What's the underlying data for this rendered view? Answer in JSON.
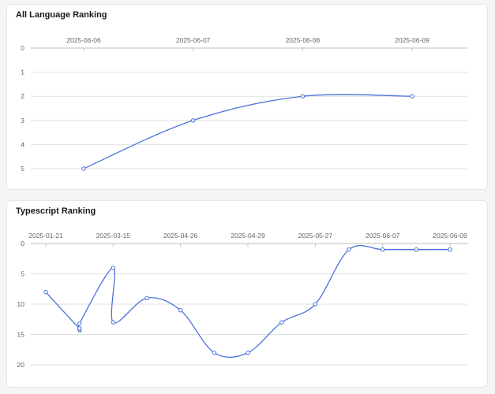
{
  "colors": {
    "line": "#4a72d8",
    "grid": "#e0e0e0",
    "axis": "#bfbfbf",
    "text": "#666666"
  },
  "charts": [
    {
      "title": "All Language Ranking",
      "chart_data": {
        "type": "line",
        "x_axis_position": "top",
        "y_inverted": true,
        "ylim": [
          0,
          5
        ],
        "y_ticks": [
          0,
          1,
          2,
          3,
          4,
          5
        ],
        "x_labels": [
          "2025-06-06",
          "2025-06-07",
          "2025-06-08",
          "2025-06-09"
        ],
        "x": [
          0,
          1,
          2,
          3
        ],
        "values": [
          5,
          3,
          2,
          2
        ],
        "smooth": true,
        "xlabel": "",
        "ylabel": "",
        "grid": true,
        "legend": "none"
      }
    },
    {
      "title": "Typescript Ranking",
      "chart_data": {
        "type": "line",
        "x_axis_position": "top",
        "y_inverted": true,
        "ylim": [
          0,
          20
        ],
        "y_ticks": [
          0,
          5,
          10,
          15,
          20
        ],
        "x_labels": [
          "2025-01-21",
          "2025-03-15",
          "2025-04-26",
          "2025-04-29",
          "2025-05-27",
          "2025-06-07",
          "2025-06-09"
        ],
        "x_label_positions": [
          0,
          2,
          4,
          6,
          8,
          10,
          12
        ],
        "x": [
          0,
          1,
          1,
          2,
          2,
          3,
          4,
          5,
          6,
          7,
          8,
          9,
          10,
          11,
          12
        ],
        "values": [
          8,
          14,
          13.2,
          4,
          13,
          9,
          11,
          18,
          18,
          13,
          10,
          1,
          1,
          1,
          1
        ],
        "smooth": true,
        "xlabel": "",
        "ylabel": "",
        "grid": true,
        "legend": "none"
      }
    }
  ]
}
